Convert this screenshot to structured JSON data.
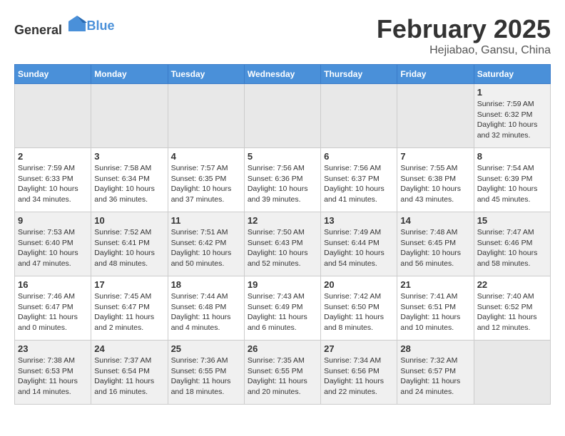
{
  "header": {
    "logo_general": "General",
    "logo_blue": "Blue",
    "month": "February 2025",
    "location": "Hejiabao, Gansu, China"
  },
  "days_of_week": [
    "Sunday",
    "Monday",
    "Tuesday",
    "Wednesday",
    "Thursday",
    "Friday",
    "Saturday"
  ],
  "weeks": [
    [
      {
        "day": "",
        "info": ""
      },
      {
        "day": "",
        "info": ""
      },
      {
        "day": "",
        "info": ""
      },
      {
        "day": "",
        "info": ""
      },
      {
        "day": "",
        "info": ""
      },
      {
        "day": "",
        "info": ""
      },
      {
        "day": "1",
        "info": "Sunrise: 7:59 AM\nSunset: 6:32 PM\nDaylight: 10 hours and 32 minutes."
      }
    ],
    [
      {
        "day": "2",
        "info": "Sunrise: 7:59 AM\nSunset: 6:33 PM\nDaylight: 10 hours and 34 minutes."
      },
      {
        "day": "3",
        "info": "Sunrise: 7:58 AM\nSunset: 6:34 PM\nDaylight: 10 hours and 36 minutes."
      },
      {
        "day": "4",
        "info": "Sunrise: 7:57 AM\nSunset: 6:35 PM\nDaylight: 10 hours and 37 minutes."
      },
      {
        "day": "5",
        "info": "Sunrise: 7:56 AM\nSunset: 6:36 PM\nDaylight: 10 hours and 39 minutes."
      },
      {
        "day": "6",
        "info": "Sunrise: 7:56 AM\nSunset: 6:37 PM\nDaylight: 10 hours and 41 minutes."
      },
      {
        "day": "7",
        "info": "Sunrise: 7:55 AM\nSunset: 6:38 PM\nDaylight: 10 hours and 43 minutes."
      },
      {
        "day": "8",
        "info": "Sunrise: 7:54 AM\nSunset: 6:39 PM\nDaylight: 10 hours and 45 minutes."
      }
    ],
    [
      {
        "day": "9",
        "info": "Sunrise: 7:53 AM\nSunset: 6:40 PM\nDaylight: 10 hours and 47 minutes."
      },
      {
        "day": "10",
        "info": "Sunrise: 7:52 AM\nSunset: 6:41 PM\nDaylight: 10 hours and 48 minutes."
      },
      {
        "day": "11",
        "info": "Sunrise: 7:51 AM\nSunset: 6:42 PM\nDaylight: 10 hours and 50 minutes."
      },
      {
        "day": "12",
        "info": "Sunrise: 7:50 AM\nSunset: 6:43 PM\nDaylight: 10 hours and 52 minutes."
      },
      {
        "day": "13",
        "info": "Sunrise: 7:49 AM\nSunset: 6:44 PM\nDaylight: 10 hours and 54 minutes."
      },
      {
        "day": "14",
        "info": "Sunrise: 7:48 AM\nSunset: 6:45 PM\nDaylight: 10 hours and 56 minutes."
      },
      {
        "day": "15",
        "info": "Sunrise: 7:47 AM\nSunset: 6:46 PM\nDaylight: 10 hours and 58 minutes."
      }
    ],
    [
      {
        "day": "16",
        "info": "Sunrise: 7:46 AM\nSunset: 6:47 PM\nDaylight: 11 hours and 0 minutes."
      },
      {
        "day": "17",
        "info": "Sunrise: 7:45 AM\nSunset: 6:47 PM\nDaylight: 11 hours and 2 minutes."
      },
      {
        "day": "18",
        "info": "Sunrise: 7:44 AM\nSunset: 6:48 PM\nDaylight: 11 hours and 4 minutes."
      },
      {
        "day": "19",
        "info": "Sunrise: 7:43 AM\nSunset: 6:49 PM\nDaylight: 11 hours and 6 minutes."
      },
      {
        "day": "20",
        "info": "Sunrise: 7:42 AM\nSunset: 6:50 PM\nDaylight: 11 hours and 8 minutes."
      },
      {
        "day": "21",
        "info": "Sunrise: 7:41 AM\nSunset: 6:51 PM\nDaylight: 11 hours and 10 minutes."
      },
      {
        "day": "22",
        "info": "Sunrise: 7:40 AM\nSunset: 6:52 PM\nDaylight: 11 hours and 12 minutes."
      }
    ],
    [
      {
        "day": "23",
        "info": "Sunrise: 7:38 AM\nSunset: 6:53 PM\nDaylight: 11 hours and 14 minutes."
      },
      {
        "day": "24",
        "info": "Sunrise: 7:37 AM\nSunset: 6:54 PM\nDaylight: 11 hours and 16 minutes."
      },
      {
        "day": "25",
        "info": "Sunrise: 7:36 AM\nSunset: 6:55 PM\nDaylight: 11 hours and 18 minutes."
      },
      {
        "day": "26",
        "info": "Sunrise: 7:35 AM\nSunset: 6:55 PM\nDaylight: 11 hours and 20 minutes."
      },
      {
        "day": "27",
        "info": "Sunrise: 7:34 AM\nSunset: 6:56 PM\nDaylight: 11 hours and 22 minutes."
      },
      {
        "day": "28",
        "info": "Sunrise: 7:32 AM\nSunset: 6:57 PM\nDaylight: 11 hours and 24 minutes."
      },
      {
        "day": "",
        "info": ""
      }
    ]
  ]
}
